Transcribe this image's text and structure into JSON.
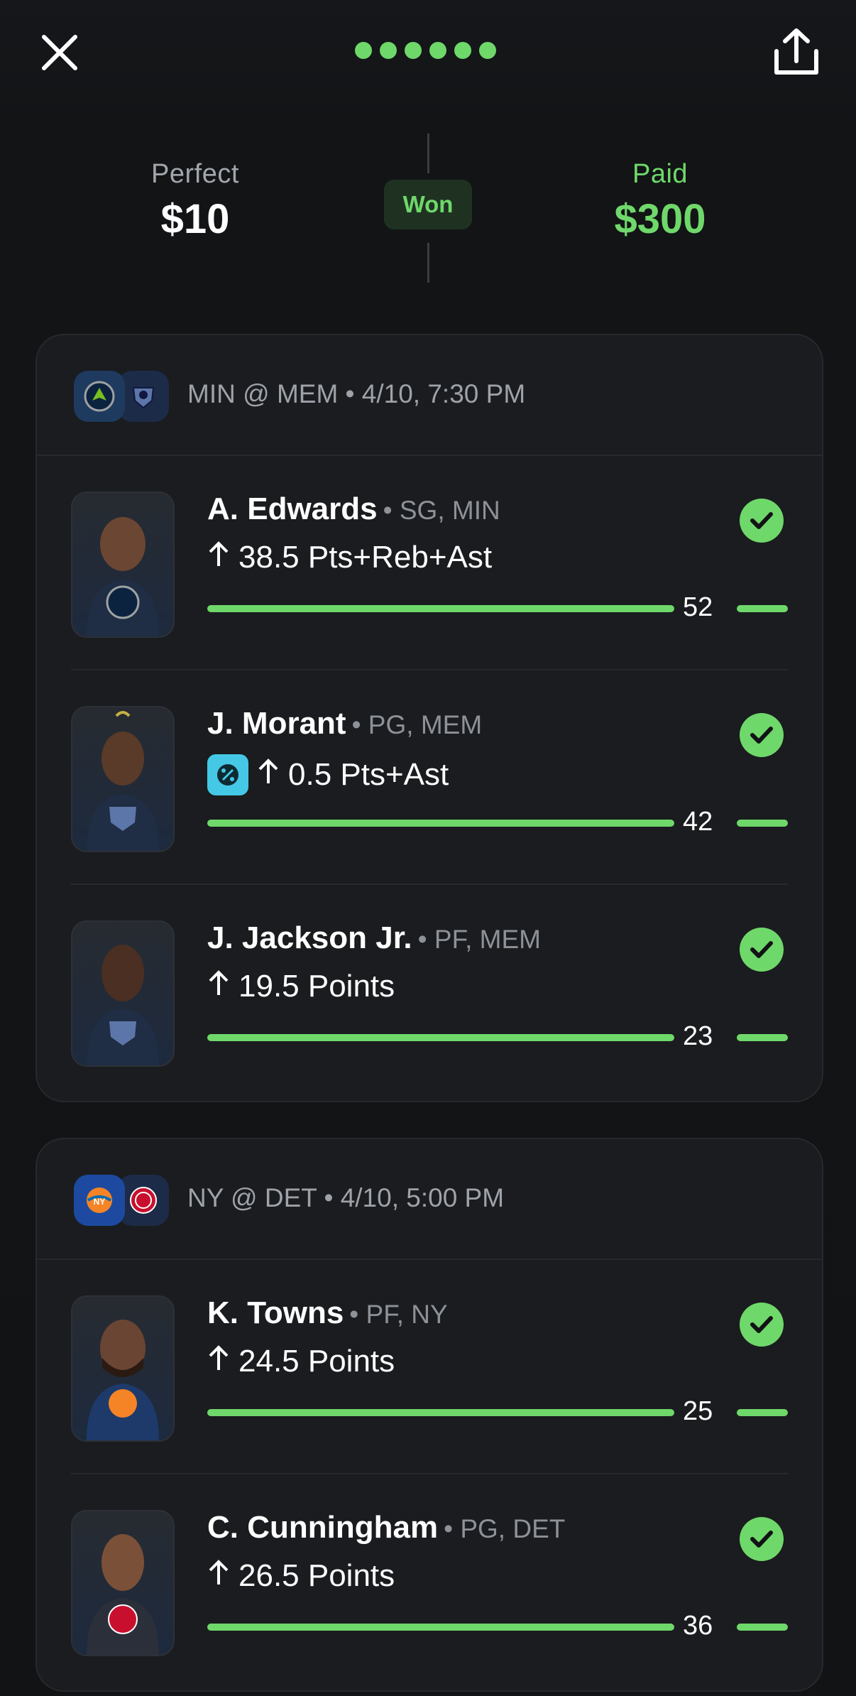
{
  "header": {
    "progress_dots": 6,
    "accent_color": "#6fd86a"
  },
  "summary": {
    "left_label": "Perfect",
    "left_value": "$10",
    "status_badge": "Won",
    "right_label": "Paid",
    "right_value": "$300"
  },
  "games": [
    {
      "matchup": "MIN @ MEM • 4/10, 7:30 PM",
      "team_icons": [
        "timberwolves-logo-icon",
        "grizzlies-logo-icon"
      ],
      "picks": [
        {
          "name": "A. Edwards",
          "meta": "• SG, MIN",
          "prop": "38.5 Pts+Reb+Ast",
          "direction": "over",
          "actual": "52",
          "boosted": false,
          "result": "hit"
        },
        {
          "name": "J. Morant",
          "meta": "• PG, MEM",
          "prop": "0.5 Pts+Ast",
          "direction": "over",
          "actual": "42",
          "boosted": true,
          "result": "hit"
        },
        {
          "name": "J. Jackson Jr.",
          "meta": "• PF, MEM",
          "prop": "19.5 Points",
          "direction": "over",
          "actual": "23",
          "boosted": false,
          "result": "hit"
        }
      ]
    },
    {
      "matchup": "NY @ DET • 4/10, 5:00 PM",
      "team_icons": [
        "knicks-logo-icon",
        "pistons-logo-icon"
      ],
      "picks": [
        {
          "name": "K. Towns",
          "meta": "• PF, NY",
          "prop": "24.5 Points",
          "direction": "over",
          "actual": "25",
          "boosted": false,
          "result": "hit"
        },
        {
          "name": "C. Cunningham",
          "meta": "• PG, DET",
          "prop": "26.5 Points",
          "direction": "over",
          "actual": "36",
          "boosted": false,
          "result": "hit"
        }
      ]
    }
  ]
}
